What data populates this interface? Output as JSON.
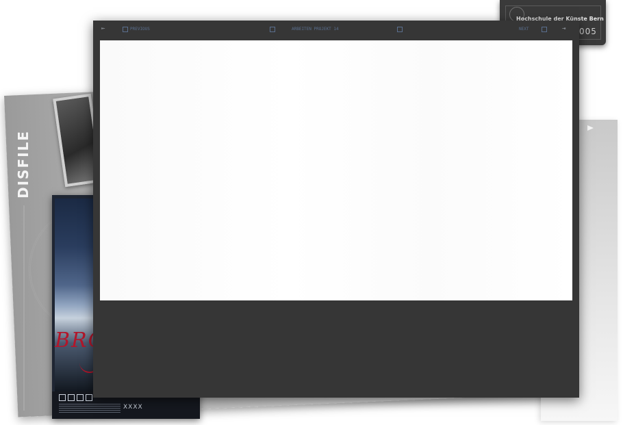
{
  "background": {
    "logo_text": "DISFILE",
    "poster": {
      "script_text": "BRO",
      "code": "AO-L007-BO13-RO3S4",
      "mark": "XXXX"
    }
  },
  "badge": {
    "institution": "Hochschule der Künste Bern",
    "year": "005"
  },
  "lightbox": {
    "toolbar": {
      "prev_label": "PREVIOUS",
      "caption": "ARBEITEN PROJEKT 14",
      "next_label": "NEXT"
    }
  }
}
